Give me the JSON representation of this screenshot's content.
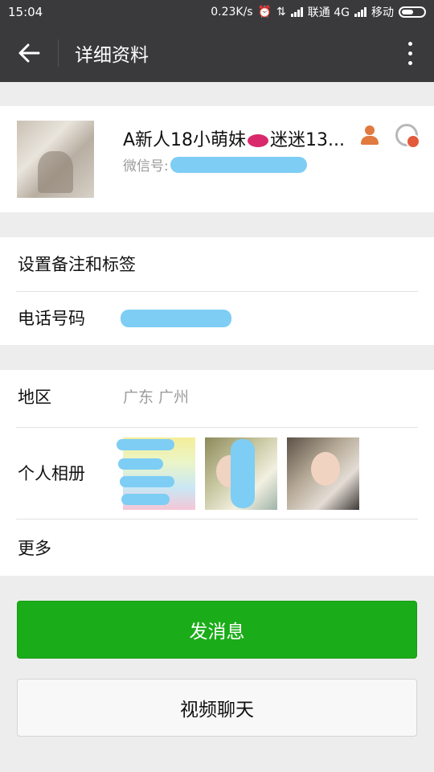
{
  "status_bar": {
    "time": "15:04",
    "speed": "0.23K/s",
    "carrier1": "联通 4G",
    "carrier2": "移动"
  },
  "header": {
    "title": "详细资料",
    "back_icon": "arrow-left-icon",
    "more_icon": "more-vertical-icon"
  },
  "profile": {
    "nickname_part1": "A新人18小萌妹",
    "nickname_part2": "迷迷13...",
    "wechat_id_label": "微信号:",
    "wechat_id_value": "",
    "gender_icon": "person-icon",
    "block_icon": "block-icon"
  },
  "rows": {
    "remark_label": "设置备注和标签",
    "phone_label": "电话号码",
    "phone_value": "",
    "region_label": "地区",
    "region_value": "广东  广州",
    "album_label": "个人相册",
    "more_label": "更多"
  },
  "buttons": {
    "message": "发消息",
    "video_call": "视频聊天"
  },
  "colors": {
    "header_bg": "#3a3a3c",
    "accent_green": "#1aad19",
    "page_bg": "#ededed",
    "redact_blue": "#7ecdf4"
  }
}
